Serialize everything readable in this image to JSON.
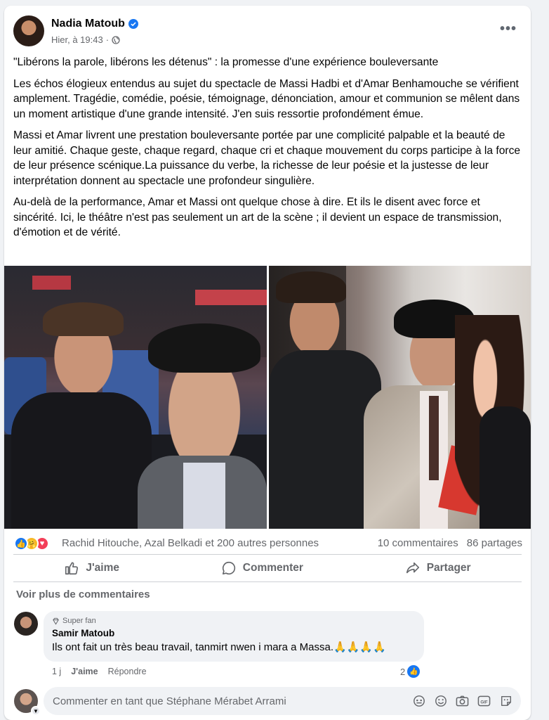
{
  "post": {
    "author": "Nadia Matoub",
    "timestamp": "Hier, à 19:43",
    "more_label": "•••",
    "paragraphs": [
      "\"Libérons la parole, libérons les détenus\" : la promesse d'une expérience bouleversante",
      "Les échos élogieux entendus au sujet du spectacle de Massi Hadbi et d'Amar Benhamouche se vérifient amplement. Tragédie, comédie, poésie, témoignage, dénonciation, amour et communion se mêlent dans un moment artistique d'une grande intensité. J'en suis ressortie profondément émue.",
      "Massi et Amar livrent une prestation bouleversante portée par une complicité palpable et la beauté de leur amitié. Chaque geste, chaque regard, chaque cri et chaque mouvement du corps participe à la force de leur présence scénique.La puissance du verbe, la richesse de leur poésie et la justesse de leur interprétation donnent au spectacle une profondeur singulière.",
      "Au-delà de la performance, Amar et Massi ont quelque chose à dire. Et ils le disent avec force et sincérité. Ici, le théâtre n'est pas seulement un art de la scène ; il devient un espace de transmission, d'émotion et de vérité."
    ]
  },
  "engagement": {
    "reaction_names": "Rachid Hitouche, Azal Belkadi et 200 autres personnes",
    "comments_count": "10 commentaires",
    "shares_count": "86 partages"
  },
  "actions": {
    "like": "J'aime",
    "comment": "Commenter",
    "share": "Partager"
  },
  "comments": {
    "see_more": "Voir plus de commentaires",
    "items": [
      {
        "badge": "Super fan",
        "author": "Samir Matoub",
        "text": "Ils ont fait un très beau travail, tanmirt nwen i mara a Massa.🙏🙏🙏🙏",
        "age": "1 j",
        "like": "J'aime",
        "reply": "Répondre",
        "likes": "2"
      }
    ]
  },
  "composer": {
    "placeholder": "Commenter en tant que Stéphane Mérabet Arrami"
  },
  "colors": {
    "accent": "#1877f2",
    "muted_text": "#65676b"
  }
}
